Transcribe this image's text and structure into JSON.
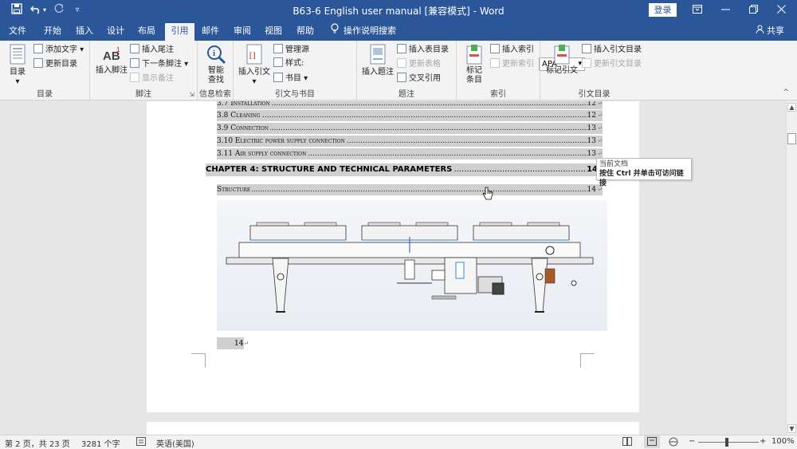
{
  "titlebar": {
    "doc_title": "B63-6 English user manual [兼容模式] - Word",
    "login": "登录",
    "qa_icons": [
      "save-icon",
      "undo-icon",
      "redo-icon",
      "customize-icon"
    ]
  },
  "tabs": [
    {
      "label": "文件"
    },
    {
      "label": "开始"
    },
    {
      "label": "插入"
    },
    {
      "label": "设计"
    },
    {
      "label": "布局"
    },
    {
      "label": "引用"
    },
    {
      "label": "邮件"
    },
    {
      "label": "审阅"
    },
    {
      "label": "视图"
    },
    {
      "label": "帮助"
    }
  ],
  "search_tab": "操作说明搜索",
  "share": "共享",
  "ribbon": {
    "toc": {
      "group": "目录",
      "big": "目录",
      "add_text": "添加文字",
      "update_toc": "更新目录"
    },
    "footnotes": {
      "group": "脚注",
      "big": "插入脚注",
      "insert_endnote": "插入尾注",
      "next_footnote": "下一条脚注",
      "show_notes": "显示备注"
    },
    "research": {
      "group": "信息检索",
      "big_line1": "智能",
      "big_line2": "查找"
    },
    "citations": {
      "group": "引文与书目",
      "big": "插入引文",
      "manage_sources": "管理源",
      "style_label": "样式:",
      "style_value": "APA",
      "bibliography": "书目"
    },
    "captions": {
      "group": "题注",
      "big": "插入题注",
      "insert_tof": "插入表目录",
      "update_table": "更新表格",
      "cross_ref": "交叉引用"
    },
    "index": {
      "group": "索引",
      "big_line1": "标记",
      "big_line2": "条目",
      "insert_index": "插入索引",
      "update_index": "更新索引"
    },
    "toa": {
      "group": "引文目录",
      "big": "标记引文",
      "insert_toa": "插入引文目录",
      "update_toa": "更新引文目录"
    }
  },
  "document": {
    "toc_entries": [
      {
        "num": "3.7",
        "title": "Installation",
        "page": "12"
      },
      {
        "num": "3.8",
        "title": "Cleaning",
        "page": "12"
      },
      {
        "num": "3.9",
        "title": "Connection",
        "page": "13"
      },
      {
        "num": "3.10",
        "title": "Electric power supply connection",
        "page": "13"
      },
      {
        "num": "3.11",
        "title": "Air supply connection",
        "page": "13"
      }
    ],
    "chapter": {
      "title": "CHAPTER 4: STRUCTURE AND TECHNICAL PARAMETERS",
      "page": "14"
    },
    "structure": {
      "title": "Structure",
      "page": "14"
    },
    "page_number": "14"
  },
  "tooltip": {
    "line1": "当前文档",
    "line2": "按住 Ctrl 并单击可访问链接"
  },
  "statusbar": {
    "page": "第 2 页，共 23 页",
    "words": "3281 个字",
    "language": "英语(美国)",
    "zoom": "100%"
  },
  "colors": {
    "accent": "#2b579a",
    "ribbon_bg": "#f3f3f3",
    "field_shading": "#cfcfcf"
  }
}
